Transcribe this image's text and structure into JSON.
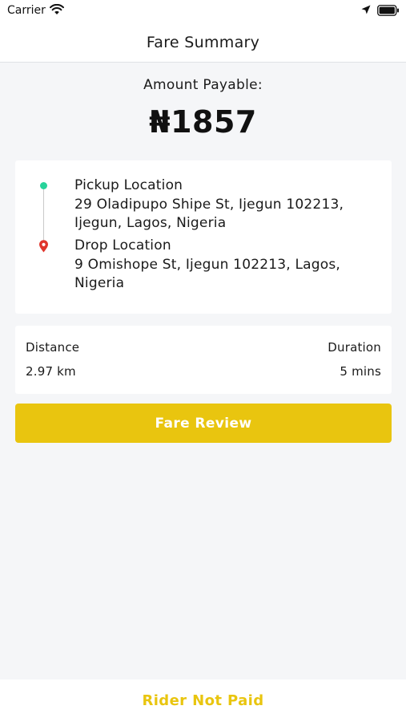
{
  "status_bar": {
    "carrier": "Carrier",
    "icons": [
      "wifi-icon",
      "location-arrow-icon",
      "battery-icon"
    ]
  },
  "nav": {
    "title": "Fare Summary"
  },
  "amount": {
    "label": "Amount Payable:",
    "value": "₦1857"
  },
  "route": {
    "pickup": {
      "title": "Pickup Location",
      "address": "29 Oladipupo Shipe St, Ijegun 102213, Ijegun, Lagos, Nigeria"
    },
    "drop": {
      "title": "Drop Location",
      "address": "9 Omishope St, Ijegun 102213, Lagos, Nigeria"
    }
  },
  "trip": {
    "distance_label": "Distance",
    "distance_value": "2.97 km",
    "duration_label": "Duration",
    "duration_value": "5 mins"
  },
  "buttons": {
    "fare_review": "Fare Review",
    "rider_not_paid": "Rider Not Paid"
  },
  "colors": {
    "accent": "#e9c50f",
    "pickup_dot": "#27d39a",
    "drop_pin": "#e0362c",
    "background": "#f5f6f8"
  }
}
